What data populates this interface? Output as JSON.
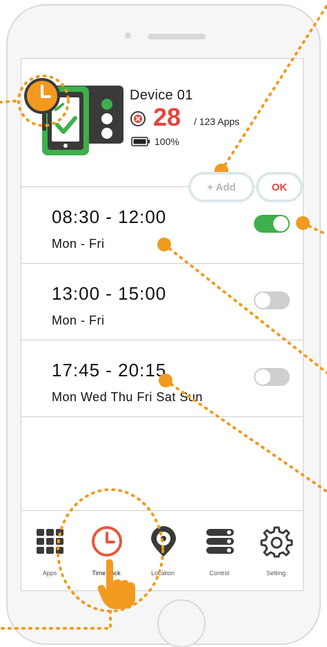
{
  "device": {
    "name": "Device 01",
    "blocked_count": "28",
    "apps_total": "/ 123 Apps",
    "battery": "100%"
  },
  "actions": {
    "add_label": "+ Add",
    "ok_label": "OK"
  },
  "schedules": [
    {
      "time": "08:30 - 12:00",
      "days": "Mon - Fri",
      "enabled": true
    },
    {
      "time": "13:00 - 15:00",
      "days": "Mon - Fri",
      "enabled": false
    },
    {
      "time": "17:45 - 20:15",
      "days": "Mon Wed Thu Fri Sat Sun",
      "enabled": false
    }
  ],
  "tabs": [
    {
      "label": "Apps",
      "icon": "apps-grid-icon"
    },
    {
      "label": "Time Lock",
      "icon": "clock-icon",
      "active": true
    },
    {
      "label": "Location",
      "icon": "location-pin-icon"
    },
    {
      "label": "Control",
      "icon": "control-list-icon"
    },
    {
      "label": "Setting",
      "icon": "gear-icon"
    }
  ],
  "colors": {
    "accent_orange": "#f29a1f",
    "alert_red": "#e8443a",
    "toggle_on_green": "#3db04b",
    "tab_active": "#e8573a",
    "tab_icon": "#3a3a3a"
  }
}
